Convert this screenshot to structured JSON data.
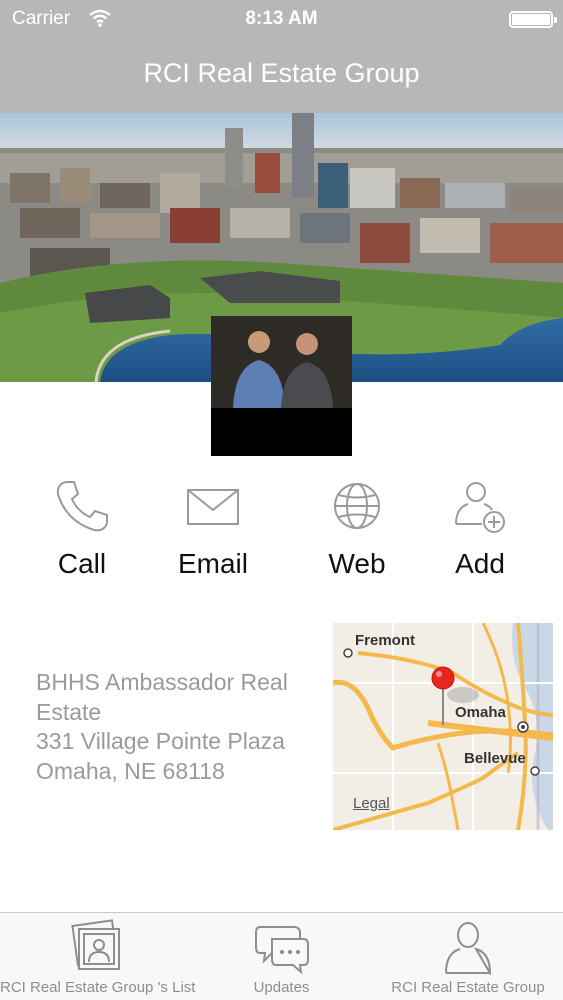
{
  "status_bar": {
    "carrier": "Carrier",
    "time": "8:13 AM"
  },
  "nav": {
    "title": "RCI Real Estate Group"
  },
  "actions": [
    {
      "label": "Call",
      "icon": "phone-icon"
    },
    {
      "label": "Email",
      "icon": "envelope-icon"
    },
    {
      "label": "Web",
      "icon": "globe-icon"
    },
    {
      "label": "Add",
      "icon": "add-contact-icon"
    }
  ],
  "address": {
    "line1": "BHHS Ambassador Real",
    "line2": "Estate",
    "line3": "331 Village Pointe Plaza",
    "line4": "Omaha, NE 68118"
  },
  "map": {
    "city1": "Fremont",
    "city2": "Omaha",
    "city3": "Bellevue",
    "legal": "Legal",
    "pin_color": "#e8261d",
    "road_color": "#f3b94d"
  },
  "tabs": [
    {
      "label": "RCI Real Estate Group 's List",
      "icon": "photos-icon"
    },
    {
      "label": "Updates",
      "icon": "chat-bubbles-icon"
    },
    {
      "label": "RCI Real Estate Group",
      "icon": "person-icon"
    }
  ]
}
